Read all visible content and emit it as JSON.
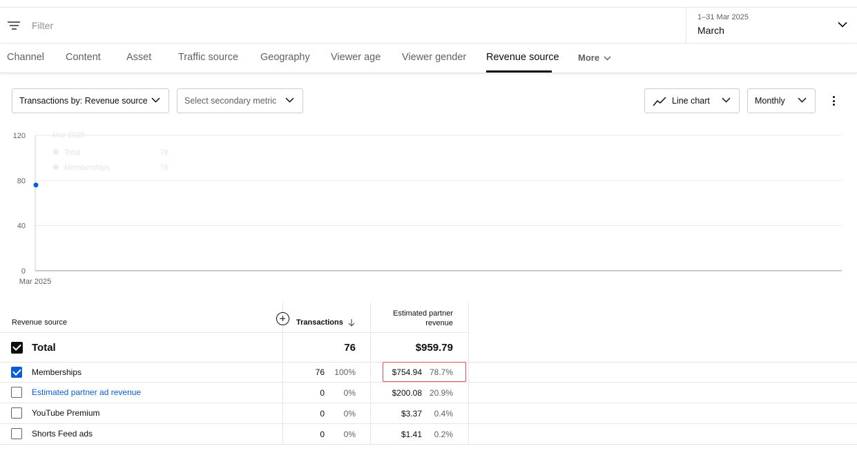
{
  "filter": {
    "placeholder": "Filter"
  },
  "date": {
    "range": "1–31 Mar 2025",
    "label": "March"
  },
  "tabs": [
    {
      "label": "Channel"
    },
    {
      "label": "Content"
    },
    {
      "label": "Asset"
    },
    {
      "label": "Traffic source"
    },
    {
      "label": "Geography"
    },
    {
      "label": "Viewer age"
    },
    {
      "label": "Viewer gender"
    },
    {
      "label": "Revenue source",
      "active": true
    }
  ],
  "more_label": "More",
  "controls": {
    "primary_metric": "Transactions by: Revenue source",
    "secondary_metric": "Select secondary metric",
    "chart_type": "Line chart",
    "interval": "Monthly"
  },
  "chart_data": {
    "type": "line",
    "x": [
      "Mar 2025"
    ],
    "series": [
      {
        "name": "Memberships",
        "values": [
          76
        ]
      }
    ],
    "ylim": [
      0,
      120
    ],
    "yticks": [
      0,
      40,
      80,
      120
    ],
    "xticks": [
      "Mar 2025"
    ],
    "grid": true,
    "tooltip": {
      "title": "Mar 2025",
      "rows": [
        {
          "name": "Total",
          "value": "76"
        },
        {
          "name": "Memberships",
          "value": "76"
        }
      ]
    }
  },
  "table": {
    "headers": {
      "dimension": "Revenue source",
      "transactions": "Transactions",
      "revenue_line1": "Estimated partner",
      "revenue_line2": "revenue"
    },
    "total": {
      "label": "Total",
      "transactions": "76",
      "revenue": "$959.79"
    },
    "rows": [
      {
        "name": "Memberships",
        "transactions": "76",
        "trans_pct": "100%",
        "revenue": "$754.94",
        "rev_pct": "78.7%",
        "checked": true,
        "link": false
      },
      {
        "name": "Estimated partner ad revenue",
        "transactions": "0",
        "trans_pct": "0%",
        "revenue": "$200.08",
        "rev_pct": "20.9%",
        "checked": false,
        "link": true
      },
      {
        "name": "YouTube Premium",
        "transactions": "0",
        "trans_pct": "0%",
        "revenue": "$3.37",
        "rev_pct": "0.4%",
        "checked": false,
        "link": false
      },
      {
        "name": "Shorts Feed ads",
        "transactions": "0",
        "trans_pct": "0%",
        "revenue": "$1.41",
        "rev_pct": "0.2%",
        "checked": false,
        "link": false
      }
    ]
  },
  "colors": {
    "accent": "#065fd4",
    "highlight": "#e05252",
    "link": "#065fd4"
  }
}
